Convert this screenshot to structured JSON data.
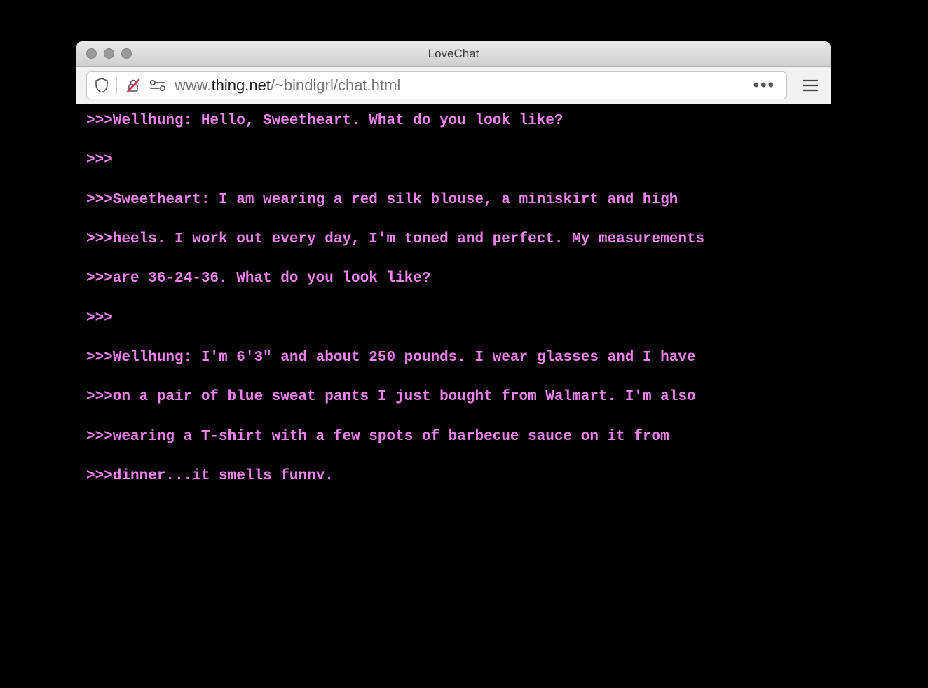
{
  "window": {
    "title": "LoveChat"
  },
  "toolbar": {
    "url_prefix": "www.",
    "url_domain": "thing.net",
    "url_path": "/~bindigrl/chat.html"
  },
  "chat": {
    "lines": [
      ">>>Wellhung: Hello, Sweetheart. What do you look like?",
      ">>>",
      ">>>Sweetheart: I am wearing a red silk blouse, a miniskirt and high",
      ">>>heels. I work out every day, I'm toned and perfect. My measurements",
      ">>>are 36-24-36. What do you look like?",
      ">>>",
      ">>>Wellhung: I'm 6'3\" and about 250 pounds. I wear glasses and I have",
      ">>>on a pair of blue sweat pants I just bought from Walmart. I'm also",
      ">>>wearing a T-shirt with a few spots of barbecue sauce on it from",
      ">>>dinner...it smells funny."
    ]
  }
}
